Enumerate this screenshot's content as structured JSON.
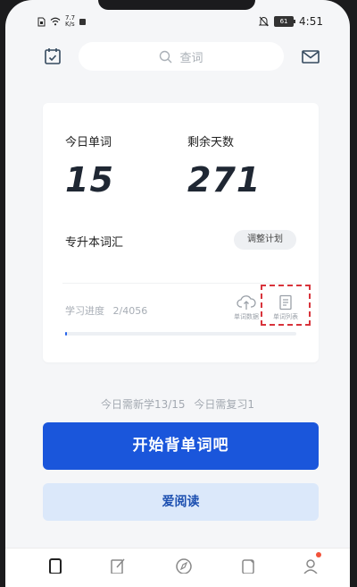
{
  "status_bar": {
    "speed_value": "7.7",
    "speed_unit": "K/s",
    "battery": "61",
    "time": "4:51"
  },
  "header": {
    "search_placeholder": "查词",
    "left_icon": "calendar-check-icon",
    "right_icon": "mail-icon"
  },
  "card": {
    "today_words_label": "今日单词",
    "today_words_value": "15",
    "days_left_label": "剩余天数",
    "days_left_value": "271",
    "book_name": "专升本词汇",
    "adjust_plan_label": "调整计划",
    "progress_label": "学习进度",
    "progress_value": "2/4056",
    "progress_fraction": 0.0005,
    "tools": [
      {
        "label": "单词数据",
        "icon": "cloud-upload-icon"
      },
      {
        "label": "单词列表",
        "icon": "list-document-icon"
      }
    ]
  },
  "summary": {
    "new_today": "今日需新学13/15",
    "review_today": "今日需复习1"
  },
  "actions": {
    "start_label": "开始背单词吧",
    "read_label": "爱阅读"
  },
  "colors": {
    "accent": "#1a56db",
    "secondary_bg": "#dbe8fa",
    "highlight": "#d8343c",
    "notification": "#f2523a"
  }
}
